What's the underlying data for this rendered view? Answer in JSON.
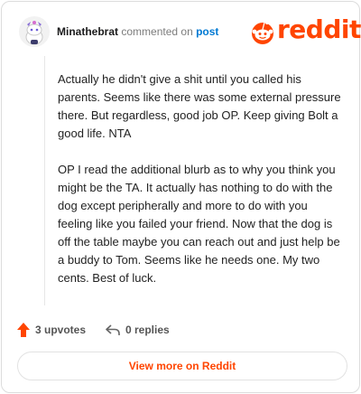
{
  "header": {
    "username": "Minathebrat",
    "commented_text": "commented on",
    "post_link": "post",
    "brand": "reddit",
    "brand_color": "#ff4500",
    "avatar_icon": "snoo-avatar-icon"
  },
  "comment": {
    "paragraphs": [
      "Actually he didn't give a shit until you called his parents. Seems like there was some external pressure there. But regardless, good job OP. Keep giving Bolt a good life. NTA",
      "OP I read the additional blurb as to why you think you might be the TA. It actually has nothing to do with the dog except peripherally and more to do with you feeling like you failed your friend. Now that the dog is off the table maybe you can reach out and just help be a buddy to Tom. Seems like he needs one. My two cents. Best of luck."
    ]
  },
  "actions": {
    "upvotes_label": "3 upvotes",
    "replies_label": "0 replies",
    "upvote_icon": "upvote-arrow-icon",
    "reply_icon": "reply-arrow-icon"
  },
  "footer": {
    "view_more_label": "View more on Reddit"
  }
}
